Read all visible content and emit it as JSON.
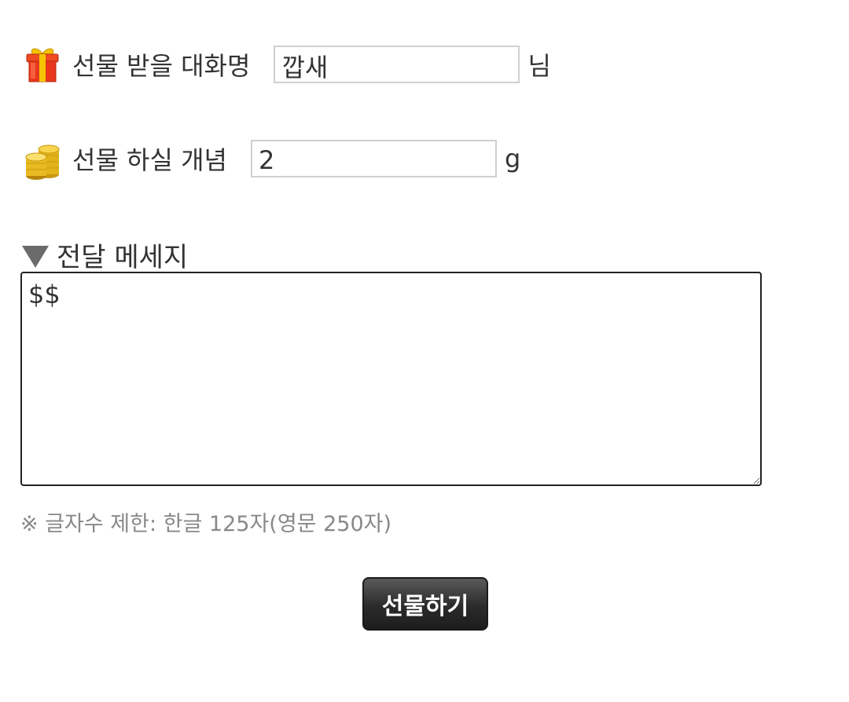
{
  "recipient": {
    "icon": "gift-box-icon",
    "label": "선물 받을 대화명",
    "value": "깝새",
    "suffix": "님"
  },
  "amount": {
    "icon": "gold-coins-icon",
    "label": "선물 하실 개념",
    "value": "2",
    "suffix": "g"
  },
  "message": {
    "icon": "triangle-down-icon",
    "title": "전달 메세지",
    "value": "$$"
  },
  "notice": "※ 글자수 제한: 한글 125자(영문 250자)",
  "submit_label": "선물하기",
  "colors": {
    "gift_red": "#e8371d",
    "gift_gold": "#f5c400",
    "coin_gold": "#e2b31a",
    "button_dark": "#2b2b2b"
  }
}
